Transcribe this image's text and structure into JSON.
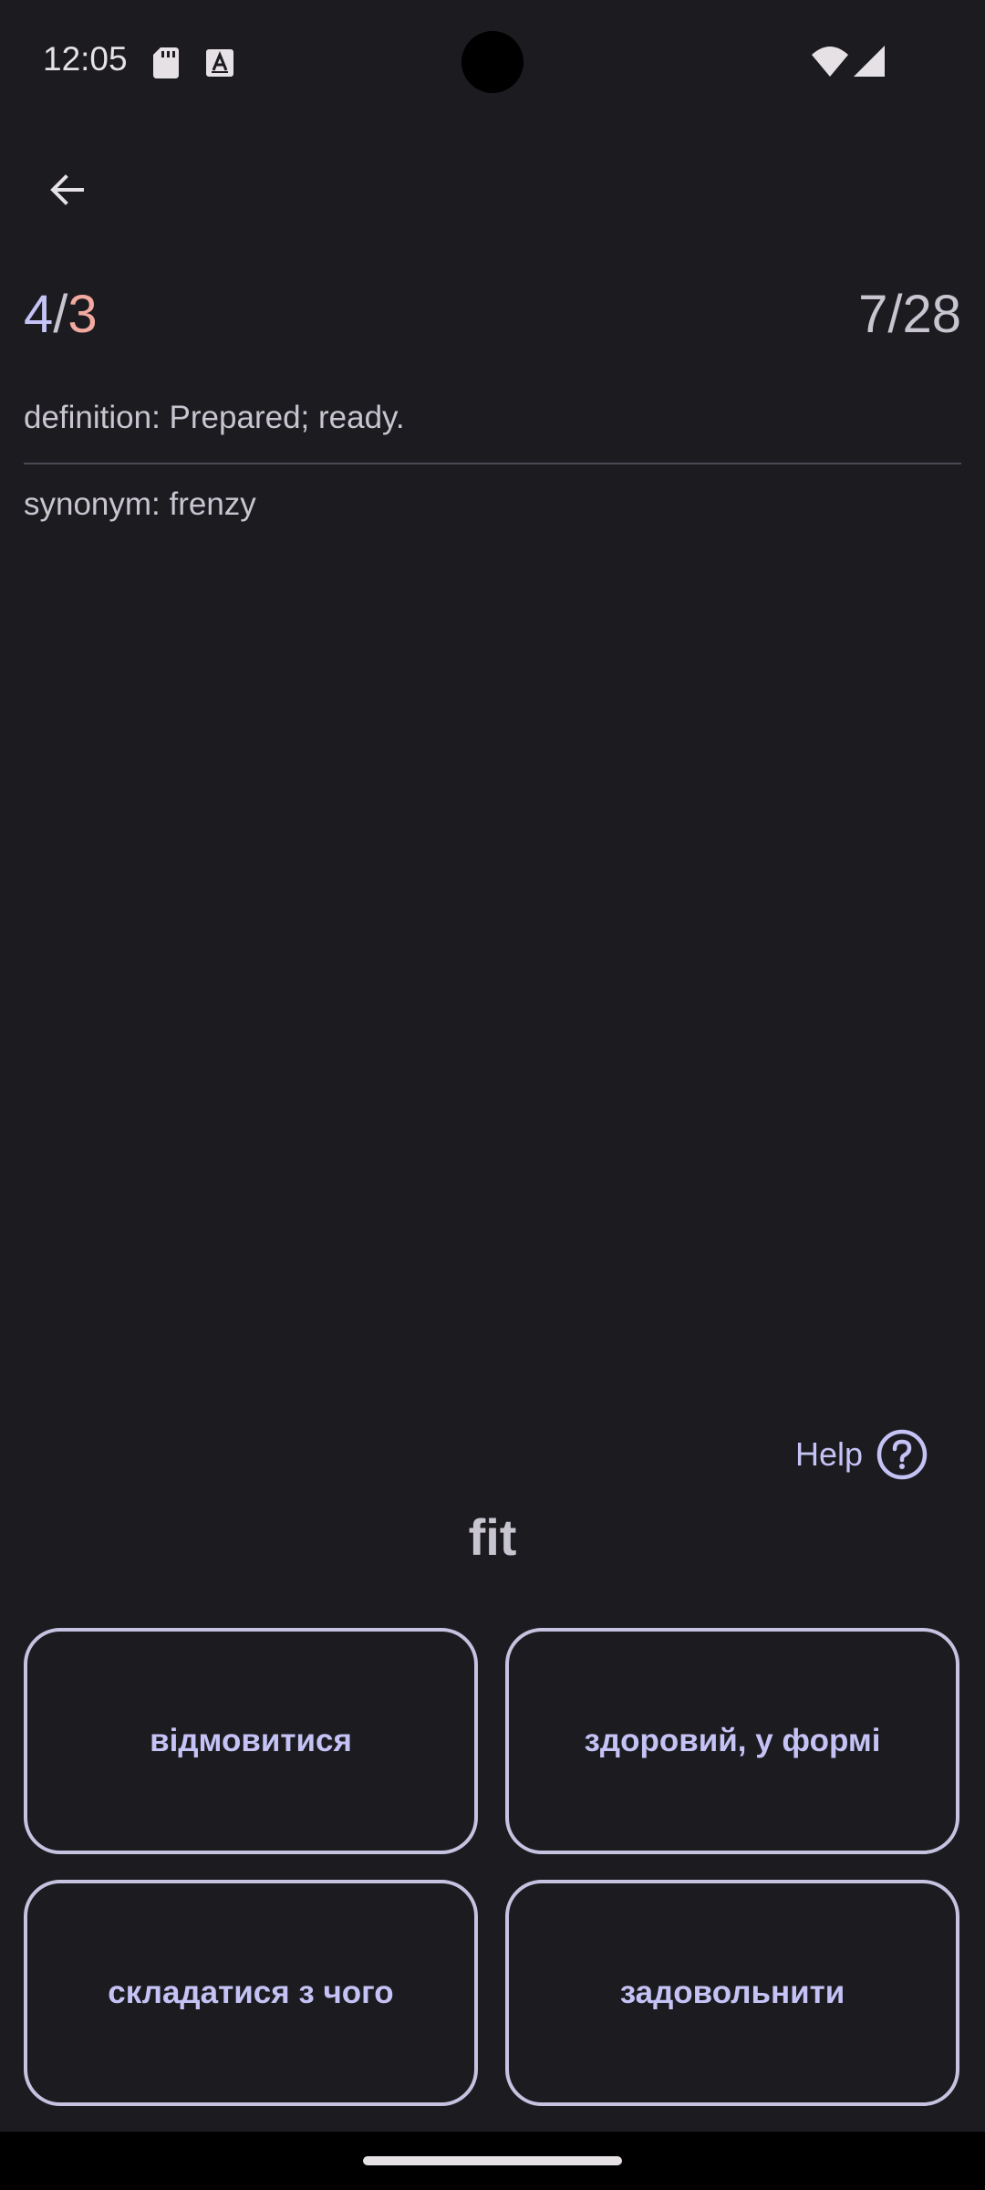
{
  "status_bar": {
    "time": "12:05",
    "icons": [
      "sd-card-icon",
      "a-text-icon",
      "wifi-icon",
      "cellular-signal-icon"
    ]
  },
  "app_bar": {
    "back_icon": "arrow-left-icon"
  },
  "score": {
    "correct": "4",
    "separator": "/",
    "wrong": "3"
  },
  "progress": "7/28",
  "card": {
    "definition": "definition: Prepared; ready.",
    "synonym": "synonym: frenzy"
  },
  "help": {
    "label": "Help",
    "icon": "question-circle-icon"
  },
  "word": "fit",
  "answers": [
    "відмовитися",
    "здоровий, у формі",
    "складатися з чого",
    "задовольнити"
  ],
  "colors": {
    "background": "#1c1b20",
    "accent": "#c5c3f5",
    "wrong": "#f2a99f",
    "text": "#c9c5d0"
  }
}
